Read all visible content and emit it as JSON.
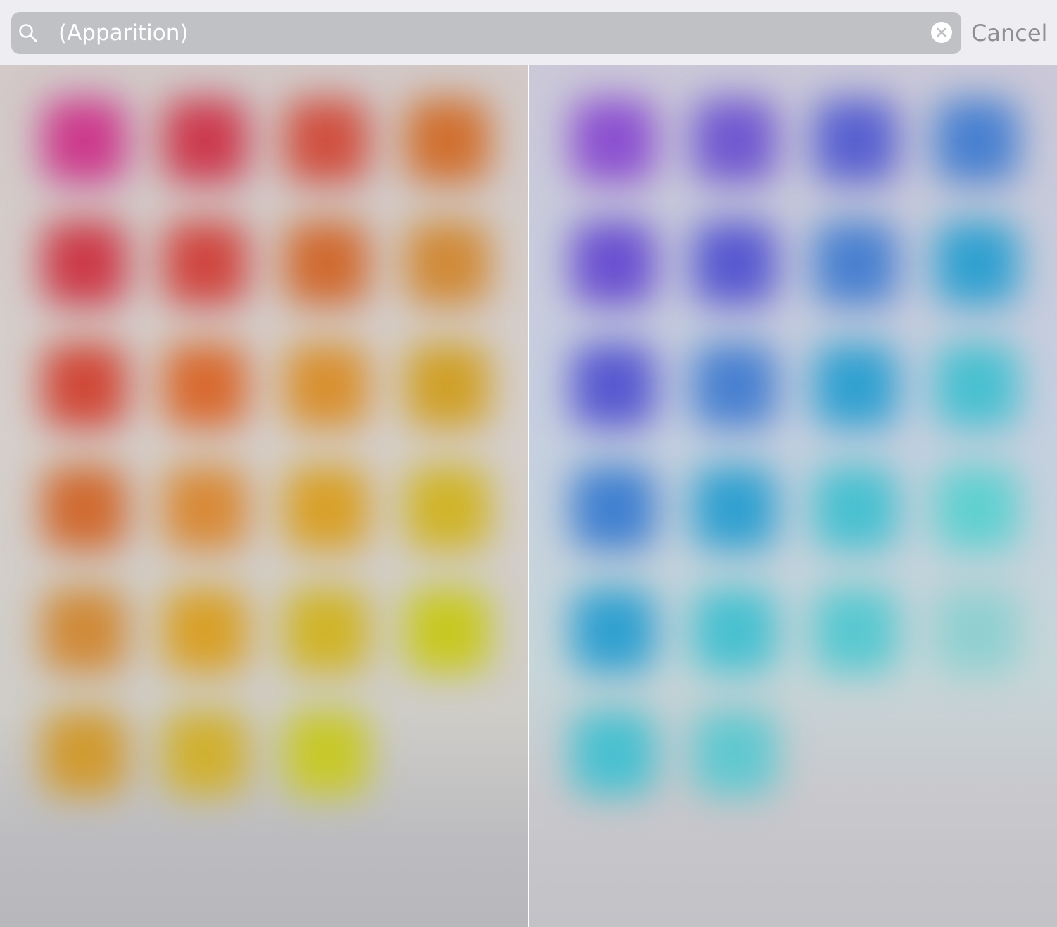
{
  "search": {
    "value": "(Apparition)",
    "cancel_label": "Cancel",
    "field_color": "#c0c1c5",
    "header_color": "#eeeef2",
    "cancel_color": "#8e8e93"
  },
  "panels": {
    "left": {
      "columns": 4,
      "icons": [
        "#cc3a8c",
        "#cc3a4e",
        "#d05040",
        "#d07030",
        "#cc3a48",
        "#d04640",
        "#d06a30",
        "#d08a38",
        "#d04838",
        "#d86a30",
        "#d89030",
        "#d0a028",
        "#d06a30",
        "#d88a38",
        "#d8a028",
        "#d0b428",
        "#d08a38",
        "#d8a028",
        "#d0b428",
        "#c8c820",
        "#d09a30",
        "#d0b030",
        "#c8c828"
      ]
    },
    "right": {
      "columns": 4,
      "icons": [
        "#8c50d0",
        "#7058d0",
        "#5860d0",
        "#4880d0",
        "#6a50d0",
        "#5858d0",
        "#4880d0",
        "#30a0d0",
        "#5858d0",
        "#4880d0",
        "#30a0d0",
        "#48c0d0",
        "#4080d0",
        "#30a0d0",
        "#48c0d0",
        "#60d0d0",
        "#30a0d0",
        "#48c0d0",
        "#58c8d0",
        "#90d0d0",
        "#48c0d0",
        "#60c8d0"
      ]
    }
  }
}
